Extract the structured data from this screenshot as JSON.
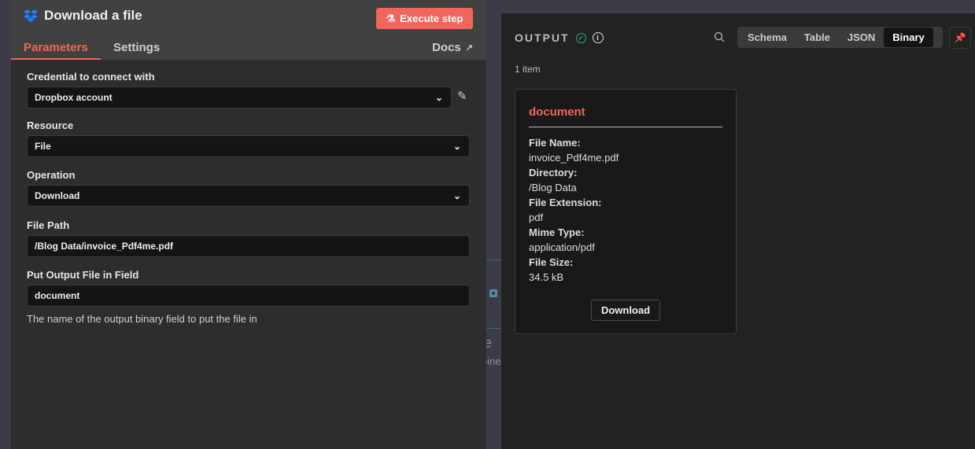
{
  "canvas": {
    "fragments": [
      "ge",
      "bine"
    ]
  },
  "node": {
    "title": "Download a file",
    "icon": "dropbox-icon",
    "execute_label": "Execute step",
    "tabs": [
      "Parameters",
      "Settings"
    ],
    "docs_label": "Docs",
    "accent": "#f0665a"
  },
  "params": {
    "credential": {
      "label": "Credential to connect with",
      "value": "Dropbox account"
    },
    "resource": {
      "label": "Resource",
      "value": "File"
    },
    "operation": {
      "label": "Operation",
      "value": "Download"
    },
    "file_path": {
      "label": "File Path",
      "value": "/Blog Data/invoice_Pdf4me.pdf"
    },
    "output_field": {
      "label": "Put Output File in Field",
      "value": "document",
      "hint": "The name of the output binary field to put the file in"
    }
  },
  "output": {
    "title": "OUTPUT",
    "views": [
      "Schema",
      "Table",
      "JSON",
      "Binary"
    ],
    "active_view": "Binary",
    "count": "1 item",
    "card": {
      "title": "document",
      "rows": [
        {
          "k": "File Name:",
          "v": "invoice_Pdf4me.pdf"
        },
        {
          "k": "Directory:",
          "v": "/Blog Data"
        },
        {
          "k": "File Extension:",
          "v": "pdf"
        },
        {
          "k": "Mime Type:",
          "v": "application/pdf"
        },
        {
          "k": "File Size:",
          "v": "34.5 kB"
        }
      ],
      "download_label": "Download"
    }
  }
}
